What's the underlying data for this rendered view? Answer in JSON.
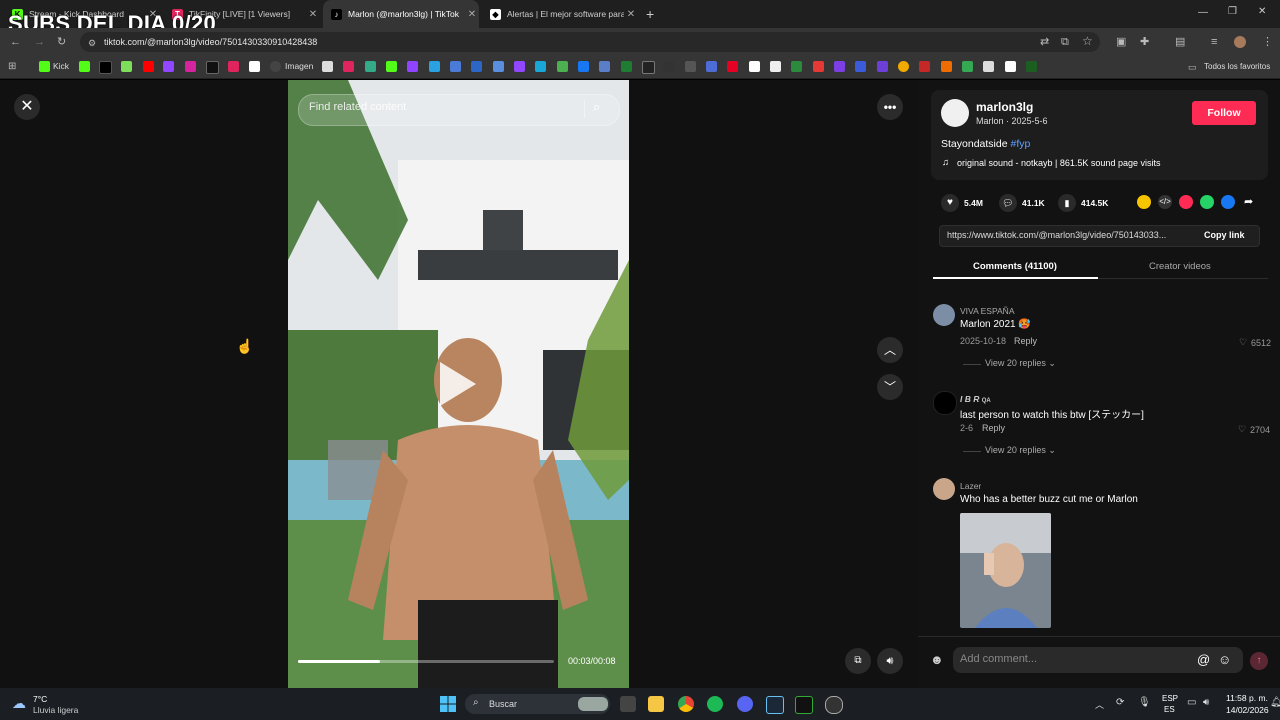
{
  "overlay": {
    "stream_text": "SUBS DEL DIA 0/20"
  },
  "tabs": [
    {
      "title": "Stream - Kick Dashboard",
      "active": false
    },
    {
      "title": "TikFinity [LIVE] [1 Viewers]",
      "active": false
    },
    {
      "title": "Marlon (@marlon3lg) | TikTok",
      "active": true
    },
    {
      "title": "Alertas | El mejor software para",
      "active": false
    }
  ],
  "address": {
    "url": "tiktok.com/@marlon3lg/video/7501430330910428438"
  },
  "bookmarks": {
    "kick": "Kick",
    "imagen": "Imagen",
    "all": "Todos los favoritos"
  },
  "video": {
    "search_placeholder": "Find related content",
    "time": "00:03/00:08",
    "progress": 0.32
  },
  "post": {
    "username": "marlon3lg",
    "meta": "Marlon · 2025-5-6",
    "follow_label": "Follow",
    "caption": "Stayondatside",
    "hashtag": "#fyp",
    "sound": "original sound - notkayb | 861.5K sound page visits",
    "likes": "5.4M",
    "comments": "41.1K",
    "saves": "414.5K",
    "link": "https://www.tiktok.com/@marlon3lg/video/750143033...",
    "copy_link": "Copy link"
  },
  "tabs_panel": {
    "comments": "Comments (41100)",
    "creator": "Creator videos"
  },
  "comments": [
    {
      "name": "VIVA ESPAÑA",
      "text": "Marlon 2021 🥵",
      "date": "2025-10-18",
      "reply": "Reply",
      "likes": "6512",
      "view_replies": "View 20 replies"
    },
    {
      "name": "I B R",
      "badge": "QA",
      "text": "last person to watch this btw [ステッカー]",
      "date": "2-6",
      "reply": "Reply",
      "likes": "2704",
      "view_replies": "View 20 replies"
    },
    {
      "name": "Lazer",
      "text": "Who has a better buzz cut me or Marlon"
    }
  ],
  "add_comment": {
    "placeholder": "Add comment..."
  },
  "taskbar": {
    "temp": "7°C",
    "weather": "Lluvia ligera",
    "search": "Buscar",
    "lang1": "ESP",
    "lang2": "ES",
    "time": "11:58 p. m.",
    "date": "14/02/2026"
  },
  "colors": {
    "follow": "#fe2c55",
    "hashtag": "#5ea1ff",
    "tabbar": "#1f1f1f",
    "chrome": "#353535"
  }
}
